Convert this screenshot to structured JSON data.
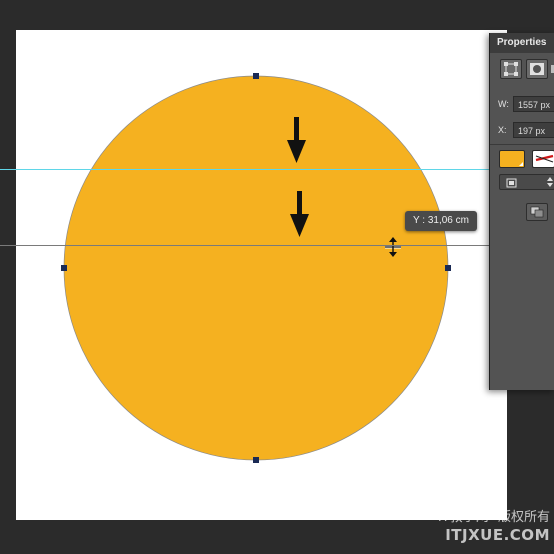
{
  "colors": {
    "shape_fill": "#f5b120",
    "canvas": "#ffffff",
    "workspace": "#2b2b2b",
    "guide_cyan": "#5fd6e8",
    "panel": "#535353"
  },
  "tooltip": {
    "text": "Y : 31,06 cm"
  },
  "properties": {
    "tab_label": "Properties",
    "width_label": "W:",
    "width_value": "1557 px",
    "x_label": "X:",
    "x_value": "197 px"
  },
  "watermark": {
    "line1": "IT教学网--版权所有",
    "line2": "ITJXUE.COM"
  },
  "icons": {
    "arrow_1": "down-arrow-icon",
    "arrow_2": "down-arrow-icon",
    "cursor": "move-vertical-cursor-icon"
  }
}
